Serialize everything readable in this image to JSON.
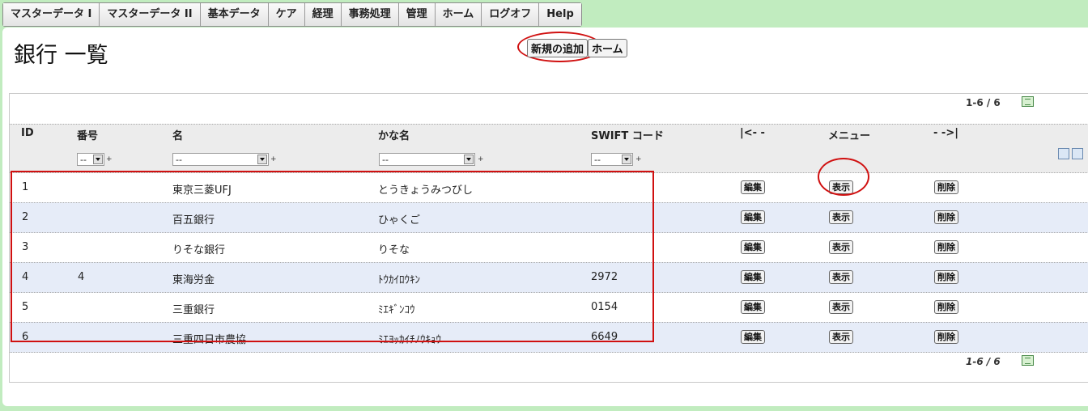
{
  "menu": [
    "マスターデータ I",
    "マスターデータ II",
    "基本データ",
    "ケア",
    "経理",
    "事務処理",
    "管理",
    "ホーム",
    "ログオフ",
    "Help"
  ],
  "page_title": "銀行 一覧",
  "buttons": {
    "add_new": "新規の追加",
    "home": "ホーム"
  },
  "pager": {
    "top": "1-6 / 6",
    "bottom": "1-6 / 6"
  },
  "columns": {
    "id": "ID",
    "number": "番号",
    "name": "名",
    "kana": "かな名",
    "swift": "SWIFT コード",
    "menu_left": "|<- -",
    "menu": "メニュー",
    "menu_right": "- ->|"
  },
  "filter_placeholder": "--",
  "actions": {
    "edit": "編集",
    "view": "表示",
    "delete": "削除"
  },
  "rows": [
    {
      "id": "1",
      "number": "",
      "name": "東京三菱UFJ",
      "kana": "とうきょうみつびし",
      "swift": ""
    },
    {
      "id": "2",
      "number": "",
      "name": "百五銀行",
      "kana": "ひゃくご",
      "swift": ""
    },
    {
      "id": "3",
      "number": "",
      "name": "りそな銀行",
      "kana": "りそな",
      "swift": ""
    },
    {
      "id": "4",
      "number": "4",
      "name": "東海労金",
      "kana": "ﾄｳｶｲﾛｳｷﾝ",
      "swift": "2972"
    },
    {
      "id": "5",
      "number": "",
      "name": "三重銀行",
      "kana": "ﾐｴｷﾞﾝｺｳ",
      "swift": "0154"
    },
    {
      "id": "6",
      "number": "",
      "name": "三重四日市農協",
      "kana": "ﾐｴﾖｯｶｲﾁﾉｳｷｮｳ",
      "swift": "6649"
    }
  ],
  "colors": {
    "background": "#c1ecbf",
    "alt_row": "#e6ecf8",
    "annotation": "#d01010"
  }
}
